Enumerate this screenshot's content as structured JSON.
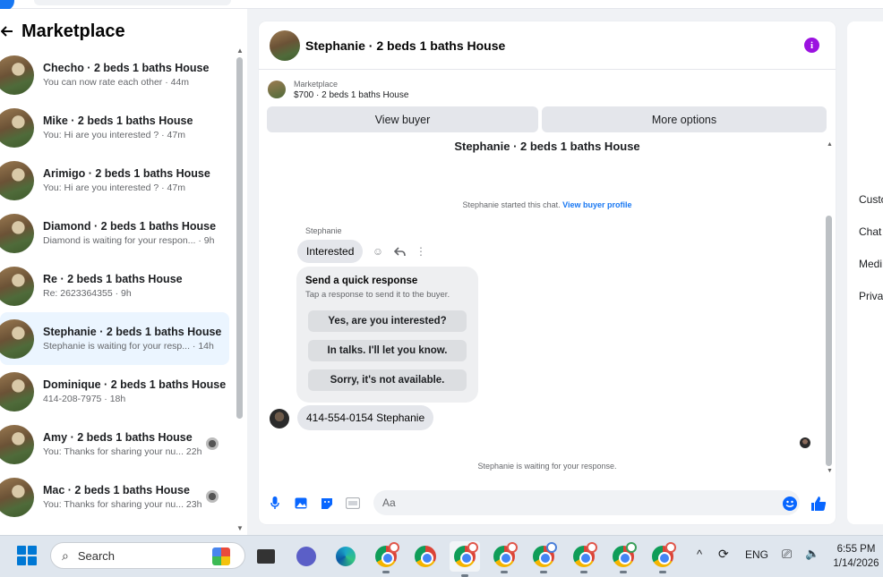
{
  "sidebar": {
    "title": "Marketplace",
    "conversations": [
      {
        "name": "Checho · 2 beds 1 baths House",
        "preview": "You can now rate each other · 44m",
        "active": false
      },
      {
        "name": "Mike · 2 beds 1 baths House",
        "preview": "You: Hi are you interested ? · 47m",
        "active": false
      },
      {
        "name": "Arimigo · 2 beds 1 baths House",
        "preview": "You: Hi are you interested ? · 47m",
        "active": false
      },
      {
        "name": "Diamond · 2 beds 1 baths House",
        "preview": "Diamond is waiting for your respon... · 9h",
        "active": false
      },
      {
        "name": "Re · 2 beds 1 baths House",
        "preview": "Re: 2623364355 · 9h",
        "active": false
      },
      {
        "name": "Stephanie · 2 beds 1 baths House",
        "preview": "Stephanie is waiting for your resp... · 14h",
        "active": true
      },
      {
        "name": "Dominique · 2 beds 1 baths House",
        "preview": "414-208-7975 · 18h",
        "active": false
      },
      {
        "name": "Amy · 2 beds 1 baths House",
        "preview": "You: Thanks for sharing your nu... 22h",
        "active": false
      },
      {
        "name": "Mac · 2 beds 1 baths House",
        "preview": "You: Thanks for sharing your nu... 23h",
        "active": false
      }
    ]
  },
  "chat": {
    "header_title": "Stephanie · 2 beds 1 baths House",
    "listing_category": "Marketplace",
    "listing_desc": "$700 · 2 beds 1 baths House",
    "view_buyer_label": "View buyer",
    "more_options_label": "More options",
    "thread_title": "Stephanie · 2 beds 1 baths House",
    "started_text": "Stephanie started this chat.",
    "view_buyer_profile": "View buyer profile",
    "sender_name": "Stephanie",
    "first_message": "Interested",
    "quick_title": "Send a quick response",
    "quick_sub": "Tap a response to send it to the buyer.",
    "quick_options": [
      "Yes, are you interested?",
      "In talks. I'll let you know.",
      "Sorry, it's not available."
    ],
    "phone_message": "414-554-0154 Stephanie",
    "waiting_text": "Stephanie is waiting for your response.",
    "composer_placeholder": "Aa"
  },
  "right_panel": {
    "items": [
      "Custo",
      "Chat",
      "Medi",
      "Priva"
    ]
  },
  "taskbar": {
    "search_label": "Search",
    "language": "ENG",
    "time": "6:55 PM",
    "date": "1/14/2026"
  }
}
